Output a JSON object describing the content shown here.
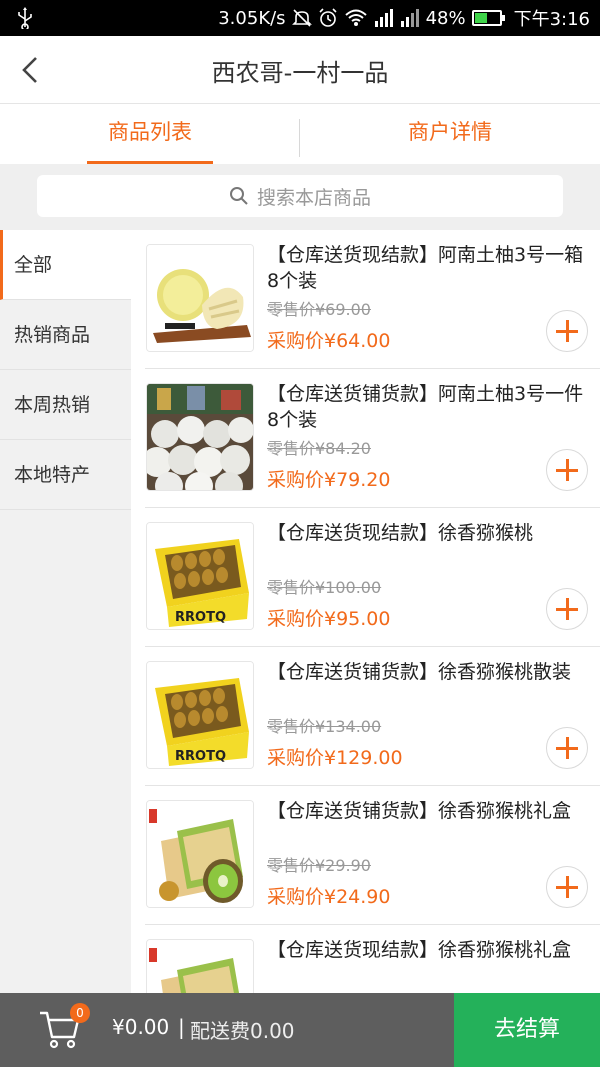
{
  "status_bar": {
    "speed": "3.05K/s",
    "battery": "48%",
    "battery_level": 0.48,
    "time": "下午3:16"
  },
  "header": {
    "title": "西农哥-一村一品",
    "back_icon": "chevron-left-icon"
  },
  "tabs": [
    {
      "label": "商品列表",
      "active": true
    },
    {
      "label": "商户详情",
      "active": false
    }
  ],
  "search": {
    "placeholder": "搜索本店商品",
    "icon": "search-icon"
  },
  "sidebar": {
    "items": [
      {
        "label": "全部",
        "active": true
      },
      {
        "label": "热销商品",
        "active": false
      },
      {
        "label": "本周热销",
        "active": false
      },
      {
        "label": "本地特产",
        "active": false
      }
    ]
  },
  "products": [
    {
      "name": "【仓库送货现结款】阿南土柚3号一箱8个装",
      "retail": "零售价¥69.00",
      "price": "采购价¥64.00",
      "image": "pomelo-cut"
    },
    {
      "name": "【仓库送货铺货款】阿南土柚3号一件8个装",
      "retail": "零售价¥84.20",
      "price": "采购价¥79.20",
      "image": "pomelo-pile"
    },
    {
      "name": "【仓库送货现结款】徐香猕猴桃",
      "retail": "零售价¥100.00",
      "price": "采购价¥95.00",
      "image": "kiwi-box",
      "box_label": "RROTQ"
    },
    {
      "name": "【仓库送货铺货款】徐香猕猴桃散装",
      "retail": "零售价¥134.00",
      "price": "采购价¥129.00",
      "image": "kiwi-box",
      "box_label": "RROTQ"
    },
    {
      "name": "【仓库送货铺货款】徐香猕猴桃礼盒",
      "retail": "零售价¥29.90",
      "price": "采购价¥24.90",
      "image": "kiwi-gift"
    },
    {
      "name": "【仓库送货现结款】徐香猕猴桃礼盒",
      "retail": "",
      "price": "",
      "image": "kiwi-gift"
    }
  ],
  "bottom_bar": {
    "cart_count": "0",
    "total": "¥0.00",
    "separator": "|",
    "delivery_fee": "配送费0.00",
    "checkout_label": "去结算"
  },
  "colors": {
    "accent": "#f26a1b",
    "checkout_green": "#24b15a",
    "bottom_bar": "#5e5e5e"
  }
}
